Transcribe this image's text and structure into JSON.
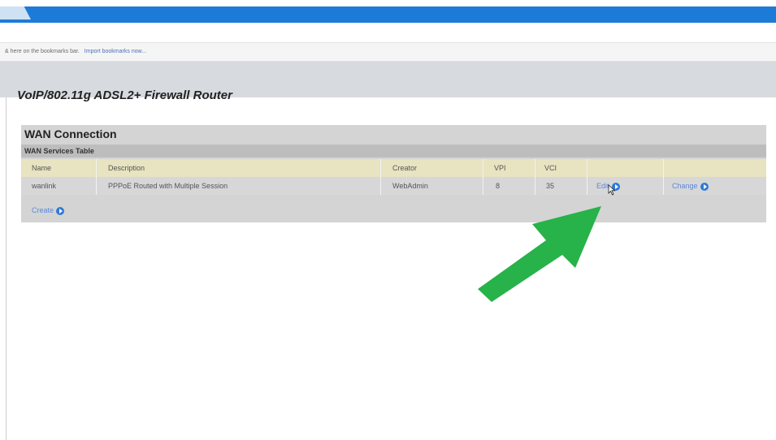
{
  "browser": {
    "bookmarks_bar_text": "& here on the bookmarks bar.",
    "bookmarks_bar_link": "Import bookmarks now..."
  },
  "page": {
    "title": "VoIP/802.11g ADSL2+ Firewall Router"
  },
  "wan": {
    "title": "WAN Connection",
    "subtitle": "WAN Services Table",
    "columns": [
      "Name",
      "Description",
      "Creator",
      "VPI",
      "VCI"
    ],
    "rows": [
      {
        "name": "wanlink",
        "description": "PPPoE Routed with Multiple Session",
        "creator": "WebAdmin",
        "vpi": "8",
        "vci": "35",
        "edit_label": "Edit",
        "change_label": "Change"
      }
    ],
    "create_label": "Create"
  },
  "colors": {
    "header_band": "#1d7bd8",
    "table_header": "#e8e3c0",
    "panel": "#d4d4d4",
    "link": "#5b89d6",
    "annotation_arrow": "#27b24a"
  },
  "icons": [
    "go-arrow-circle-icon",
    "mouse-pointer-icon",
    "annotation-arrow-icon"
  ]
}
